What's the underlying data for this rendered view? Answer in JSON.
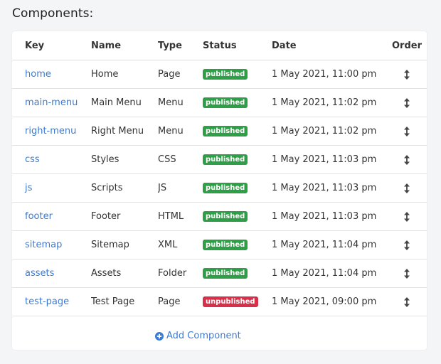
{
  "page": {
    "heading": "Components:"
  },
  "table": {
    "columns": {
      "key": "Key",
      "name": "Name",
      "type": "Type",
      "status": "Status",
      "date": "Date",
      "order": "Order"
    },
    "rows": [
      {
        "key": "home",
        "name": "Home",
        "type": "Page",
        "status": "published",
        "date": "1 May 2021, 11:00 pm"
      },
      {
        "key": "main-menu",
        "name": "Main Menu",
        "type": "Menu",
        "status": "published",
        "date": "1 May 2021, 11:02 pm"
      },
      {
        "key": "right-menu",
        "name": "Right Menu",
        "type": "Menu",
        "status": "published",
        "date": "1 May 2021, 11:02 pm"
      },
      {
        "key": "css",
        "name": "Styles",
        "type": "CSS",
        "status": "published",
        "date": "1 May 2021, 11:03 pm"
      },
      {
        "key": "js",
        "name": "Scripts",
        "type": "JS",
        "status": "published",
        "date": "1 May 2021, 11:03 pm"
      },
      {
        "key": "footer",
        "name": "Footer",
        "type": "HTML",
        "status": "published",
        "date": "1 May 2021, 11:03 pm"
      },
      {
        "key": "sitemap",
        "name": "Sitemap",
        "type": "XML",
        "status": "published",
        "date": "1 May 2021, 11:04 pm"
      },
      {
        "key": "assets",
        "name": "Assets",
        "type": "Folder",
        "status": "published",
        "date": "1 May 2021, 11:04 pm"
      },
      {
        "key": "test-page",
        "name": "Test Page",
        "type": "Page",
        "status": "unpublished",
        "date": "1 May 2021, 09:00 pm"
      }
    ],
    "order_icon": "vertical-arrows-icon"
  },
  "actions": {
    "add_label": "Add Component",
    "add_icon": "plus-circle-icon"
  },
  "colors": {
    "link": "#3a7bd5",
    "published": "#2e9e47",
    "unpublished": "#d6304a",
    "background": "#f4f5f7",
    "card": "#ffffff"
  }
}
